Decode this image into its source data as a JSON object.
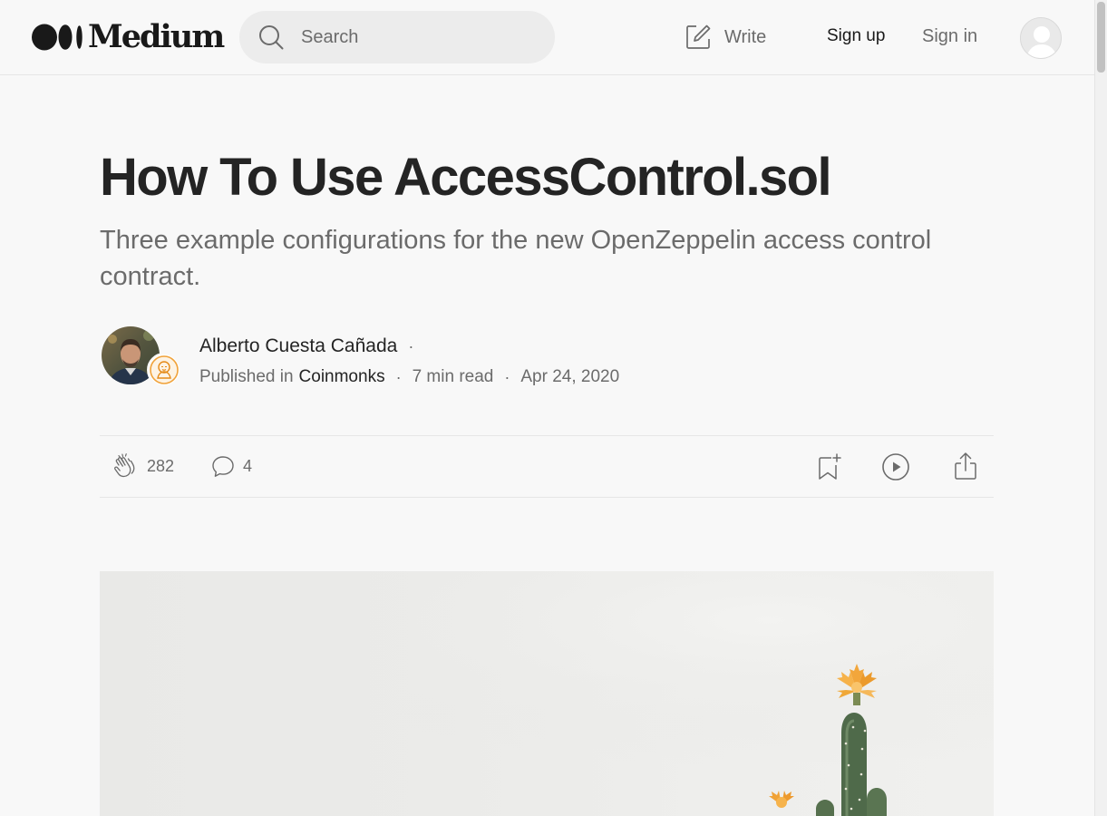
{
  "header": {
    "logo_text": "Medium",
    "search_placeholder": "Search",
    "write_label": "Write",
    "signup_label": "Sign up",
    "signin_label": "Sign in"
  },
  "article": {
    "title": "How To Use AccessControl.sol",
    "subtitle": "Three example configurations for the new OpenZeppelin access control contract.",
    "author": "Alberto Cuesta Cañada",
    "author_separator": "·",
    "published_in_label": "Published in",
    "publication": "Coinmonks",
    "read_time": "7 min read",
    "date": "Apr 24, 2020",
    "meta_separator": "·"
  },
  "actions": {
    "claps": "282",
    "responses": "4"
  },
  "colors": {
    "background": "#f8f8f8",
    "text_primary": "#242424",
    "text_secondary": "#6b6b6b",
    "search_bg": "#ececec",
    "divider": "#e6e6e6"
  },
  "icons": [
    "medium-logo-icon",
    "search-icon",
    "write-icon",
    "user-avatar-icon",
    "clap-icon",
    "response-icon",
    "bookmark-add-icon",
    "play-icon",
    "share-icon",
    "publication-badge-icon"
  ]
}
